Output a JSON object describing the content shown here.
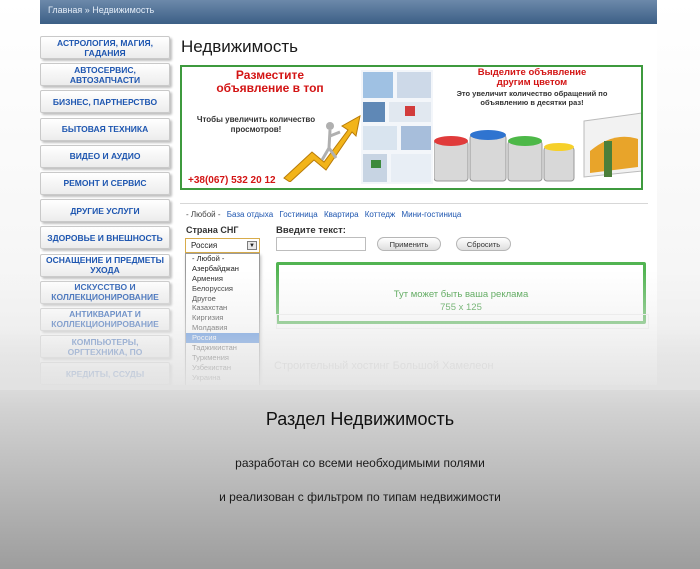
{
  "breadcrumb": "Главная » Недвижимость",
  "sidebar": {
    "items": [
      {
        "label": "АСТРОЛОГИЯ, МАГИЯ, ГАДАНИЯ"
      },
      {
        "label": "АВТОСЕРВИС, АВТОЗАПЧАСТИ"
      },
      {
        "label": "БИЗНЕС, ПАРТНЕРСТВО"
      },
      {
        "label": "БЫТОВАЯ ТЕХНИКА"
      },
      {
        "label": "ВИДЕО И АУДИО"
      },
      {
        "label": "РЕМОНТ И СЕРВИС"
      },
      {
        "label": "ДРУГИЕ УСЛУГИ"
      },
      {
        "label": "ЗДОРОВЬЕ И ВНЕШНОСТЬ"
      },
      {
        "label": "ОСНАЩЕНИЕ И ПРЕДМЕТЫ УХОДА"
      },
      {
        "label": "ИСКУССТВО И КОЛЛЕКЦИОНИРОВАНИЕ"
      },
      {
        "label": "АНТИКВАРИАТ И КОЛЛЕКЦИОНИРОВАНИЕ"
      },
      {
        "label": "КОМПЬЮТЕРЫ, ОРГТЕХНИКА, ПО"
      },
      {
        "label": "КРЕДИТЫ, ССУДЫ"
      }
    ]
  },
  "main": {
    "title": "Недвижимость"
  },
  "banner": {
    "left_headline": "Разместите объявление в топ",
    "left_sub": "Чтобы увеличить количество просмотров!",
    "phone": "+38(067) 532 20 12",
    "right_headline": "Выделите объявление другим цветом",
    "right_sub": "Это увеличит количество обращений по объявлению в десятки раз!"
  },
  "filter": {
    "types": [
      {
        "label": "- Любой -"
      },
      {
        "label": "База отдыха"
      },
      {
        "label": "Гостиница"
      },
      {
        "label": "Квартира"
      },
      {
        "label": "Коттедж"
      },
      {
        "label": "Мини-гостиница"
      }
    ],
    "country_label": "Страна СНГ",
    "text_label": "Введите текст:",
    "country_selected": "Россия",
    "apply_button": "Применить",
    "reset_button": "Сбросить",
    "country_options": [
      {
        "label": "- Любой -"
      },
      {
        "label": "Азербайджан"
      },
      {
        "label": "Армения"
      },
      {
        "label": "Белоруссия"
      },
      {
        "label": "Другое"
      },
      {
        "label": "Казахстан"
      },
      {
        "label": "Киргизия"
      },
      {
        "label": "Молдавия"
      },
      {
        "label": "Россия"
      },
      {
        "label": "Таджикистан"
      },
      {
        "label": "Туркмения"
      },
      {
        "label": "Узбекистан"
      },
      {
        "label": "Украина"
      }
    ]
  },
  "ad": {
    "line1": "Тут может быть ваша реклама",
    "line2": "755 x 125"
  },
  "listing_title": "Строительный хостинг Большой Хамелеон",
  "caption": {
    "title": "Раздел Недвижимость",
    "line1": "разработан со всеми необходимыми полями",
    "line2": "и реализован с фильтром по типам недвижимости"
  },
  "colors": {
    "link_blue": "#1e56b0",
    "ad_green": "#52b452",
    "banner_red": "#d31414",
    "selected_blue": "#3479db"
  }
}
